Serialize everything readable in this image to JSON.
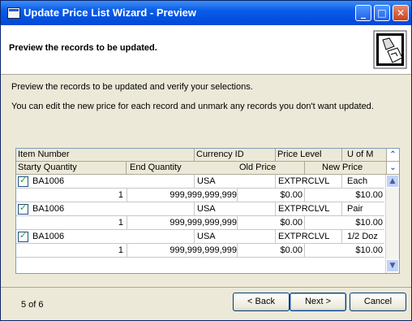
{
  "window": {
    "title": "Update Price List Wizard - Preview"
  },
  "header": {
    "title": "Preview the records to be updated."
  },
  "instructions": [
    "Preview the records to be updated and verify your selections.",
    "You can edit the new price for each record and unmark any records you don't want updated."
  ],
  "grid": {
    "header_row1": [
      "Item Number",
      "Currency ID",
      "Price Level",
      "U of M"
    ],
    "header_row2": [
      "Starty Quantity",
      "End Quantity",
      "Old Price",
      "New Price"
    ],
    "records": [
      {
        "checked": true,
        "item": "BA1006",
        "currency": "USA",
        "level": "EXTPRCLVL",
        "uom": "Each",
        "start": "1",
        "end": "999,999,999,999",
        "old": "$0.00",
        "new": "$10.00"
      },
      {
        "checked": true,
        "item": "BA1006",
        "currency": "USA",
        "level": "EXTPRCLVL",
        "uom": "Pair",
        "start": "1",
        "end": "999,999,999,999",
        "old": "$0.00",
        "new": "$10.00"
      },
      {
        "checked": true,
        "item": "BA1006",
        "currency": "USA",
        "level": "EXTPRCLVL",
        "uom": "1/2 Doz",
        "start": "1",
        "end": "999,999,999,999",
        "old": "$0.00",
        "new": "$10.00"
      }
    ]
  },
  "footer": {
    "page_info": "5 of 6",
    "back_label": "< Back",
    "next_label": "Next >",
    "cancel_label": "Cancel"
  },
  "icons": {
    "window": "window-icon",
    "wizard": "wizard-icon",
    "sort_up": "sort-up-icon",
    "sort_down": "sort-down-icon"
  },
  "colors": {
    "titlebar": "#0a5ce8",
    "dialog": "#ece9d8",
    "accent": "#21a121"
  }
}
